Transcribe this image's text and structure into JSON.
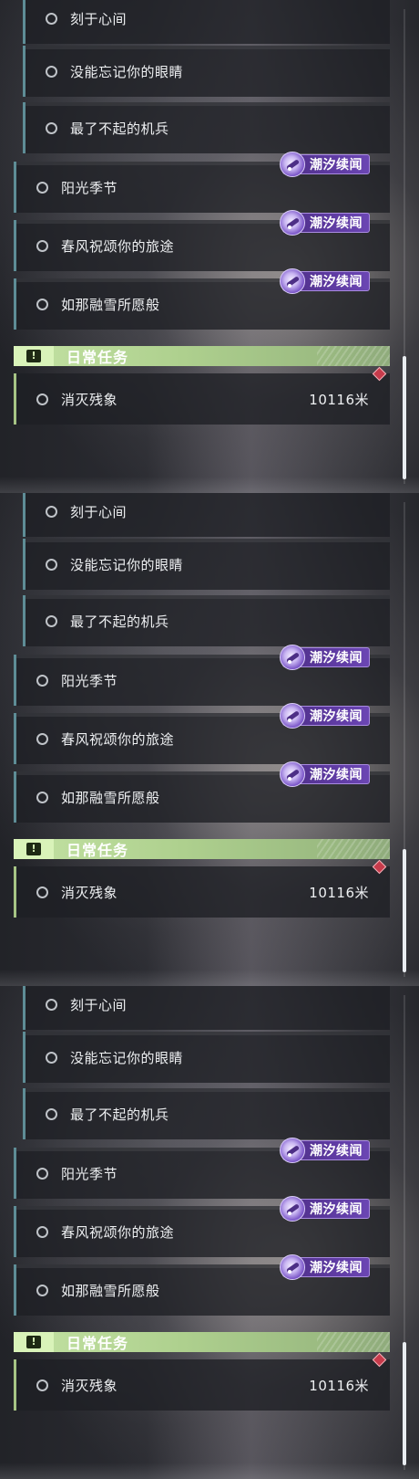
{
  "panels": [
    {
      "quests": [
        {
          "label": "刻于心间"
        },
        {
          "label": "没能忘记你的眼睛"
        },
        {
          "label": "最了不起的机兵"
        },
        {
          "label": "阳光季节",
          "badge": "潮汐续闻"
        },
        {
          "label": "春风祝颂你的旅途",
          "badge": "潮汐续闻"
        },
        {
          "label": "如那融雪所愿般",
          "badge": "潮汐续闻"
        }
      ],
      "daily": {
        "title": "日常任务",
        "alert_icon": "exclamation-icon",
        "quest_label": "消灭残象",
        "distance": "10116米",
        "marker_icon": "map-marker-icon"
      }
    },
    {
      "quests": [
        {
          "label": "刻于心间"
        },
        {
          "label": "没能忘记你的眼睛"
        },
        {
          "label": "最了不起的机兵"
        },
        {
          "label": "阳光季节",
          "badge": "潮汐续闻"
        },
        {
          "label": "春风祝颂你的旅途",
          "badge": "潮汐续闻"
        },
        {
          "label": "如那融雪所愿般",
          "badge": "潮汐续闻"
        }
      ],
      "daily": {
        "title": "日常任务",
        "alert_icon": "exclamation-icon",
        "quest_label": "消灭残象",
        "distance": "10116米",
        "marker_icon": "map-marker-icon"
      }
    },
    {
      "quests": [
        {
          "label": "刻于心间"
        },
        {
          "label": "没能忘记你的眼睛"
        },
        {
          "label": "最了不起的机兵"
        },
        {
          "label": "阳光季节",
          "badge": "潮汐续闻"
        },
        {
          "label": "春风祝颂你的旅途",
          "badge": "潮汐续闻"
        },
        {
          "label": "如那融雪所愿般",
          "badge": "潮汐续闻"
        }
      ],
      "daily": {
        "title": "日常任务",
        "alert_icon": "exclamation-icon",
        "quest_label": "消灭残象",
        "distance": "10116米",
        "marker_icon": "map-marker-icon"
      }
    }
  ],
  "colors": {
    "quest_accent": "#5e8d96",
    "daily_accent": "#a6c485",
    "badge_purple": "#5f3ba3",
    "daily_header_green": "#aed08e",
    "marker_red": "#c73b4b"
  }
}
